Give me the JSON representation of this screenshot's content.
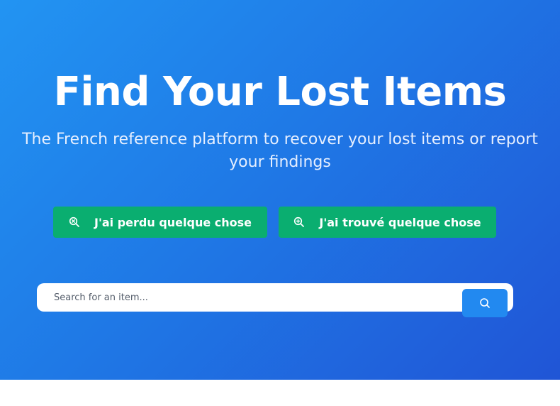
{
  "hero": {
    "title": "Find Your Lost Items",
    "subtitle": "The French reference platform to recover your lost items or report your findings"
  },
  "actions": {
    "lost_label": "J'ai perdu quelque chose",
    "lost_icon": "search-minus-icon",
    "found_label": "J'ai trouvé quelque chose",
    "found_icon": "search-plus-icon"
  },
  "search": {
    "placeholder": "Search for an item...",
    "value": "",
    "button_icon": "search-icon"
  },
  "colors": {
    "hero_gradient_start": "#2294f2",
    "hero_gradient_end": "#2055d6",
    "action_green": "#0aae70",
    "search_button_blue": "#2289f0"
  }
}
